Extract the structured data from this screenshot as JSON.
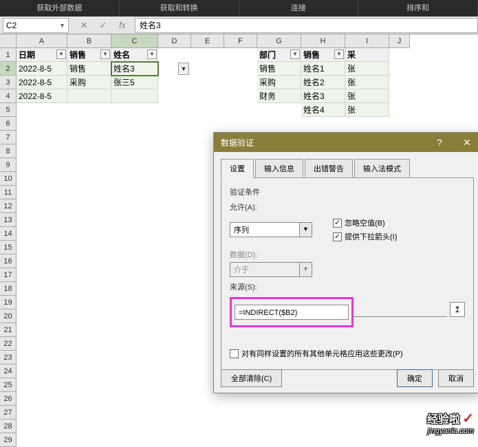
{
  "ribbon": {
    "g1": "获取外部数据",
    "g2": "获取和转换",
    "g3": "连接",
    "g4": "排序和"
  },
  "formula_bar": {
    "name_box": "C2",
    "value": "姓名3"
  },
  "columns": [
    "A",
    "B",
    "C",
    "D",
    "E",
    "F",
    "G",
    "H",
    "I",
    "J"
  ],
  "row_count": 29,
  "selected_col_idx": 2,
  "selected_row_idx": 1,
  "headers_left": {
    "A": "日期",
    "B": "销售",
    "C": "姓名"
  },
  "data_left": [
    {
      "A": "2022-8-5",
      "B": "销售",
      "C": "姓名3"
    },
    {
      "A": "2022-8-5",
      "B": "采购",
      "C": "张三5"
    },
    {
      "A": "2022-8-5",
      "B": "",
      "C": ""
    }
  ],
  "headers_right": {
    "G": "部门",
    "H": "销售",
    "I": "采"
  },
  "data_right": [
    {
      "G": "销售",
      "H": "姓名1",
      "I": "张"
    },
    {
      "G": "采购",
      "H": "姓名2",
      "I": "张"
    },
    {
      "G": "财务",
      "H": "姓名3",
      "I": "张"
    },
    {
      "G": "",
      "H": "姓名4",
      "I": "张"
    }
  ],
  "dialog": {
    "title": "数据验证",
    "tabs": [
      "设置",
      "输入信息",
      "出错警告",
      "输入法模式"
    ],
    "section_label": "验证条件",
    "allow_label": "允许(A):",
    "allow_value": "序列",
    "data_label": "数据(D):",
    "data_value": "介于",
    "ignore_blank": "忽略空值(B)",
    "dropdown_arrow": "提供下拉箭头(I)",
    "source_label": "来源(S):",
    "source_value": "=INDIRECT($B2)",
    "apply_label": "对有同样设置的所有其他单元格应用这些更改(P)",
    "clear": "全部清除(C)",
    "ok": "确定",
    "cancel": "取消"
  },
  "watermark": {
    "top": "经验啦",
    "bot": "jingyanla.com"
  }
}
